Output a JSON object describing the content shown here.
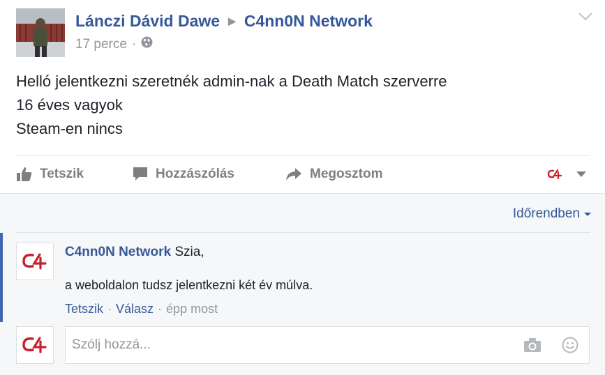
{
  "post": {
    "author": "Lánczi Dávid Dawe",
    "target": "C4nn0N Network",
    "timestamp": "17 perce",
    "privacy_icon": "globe-icon",
    "body_lines": [
      "Helló jelentkezni szeretnék admin-nak a Death Match szerverre",
      "16 éves vagyok",
      "Steam-en nincs"
    ],
    "actions": {
      "like": "Tetszik",
      "comment": "Hozzászólás",
      "share": "Megosztom"
    },
    "audience_logo": "C4"
  },
  "comments_section": {
    "order_label": "Időrendben",
    "comment": {
      "author": "C4nn0N Network",
      "text_line1": "Szia,",
      "text_line2": "a weboldalon tudsz jelentkezni két év múlva.",
      "like": "Tetszik",
      "reply": "Válasz",
      "time": "épp most"
    },
    "reply_box": {
      "placeholder": "Szólj hozzá..."
    }
  },
  "colors": {
    "link": "#365899",
    "muted": "#90949c",
    "action": "#7f7f7f",
    "logo_red": "#c8202f"
  }
}
